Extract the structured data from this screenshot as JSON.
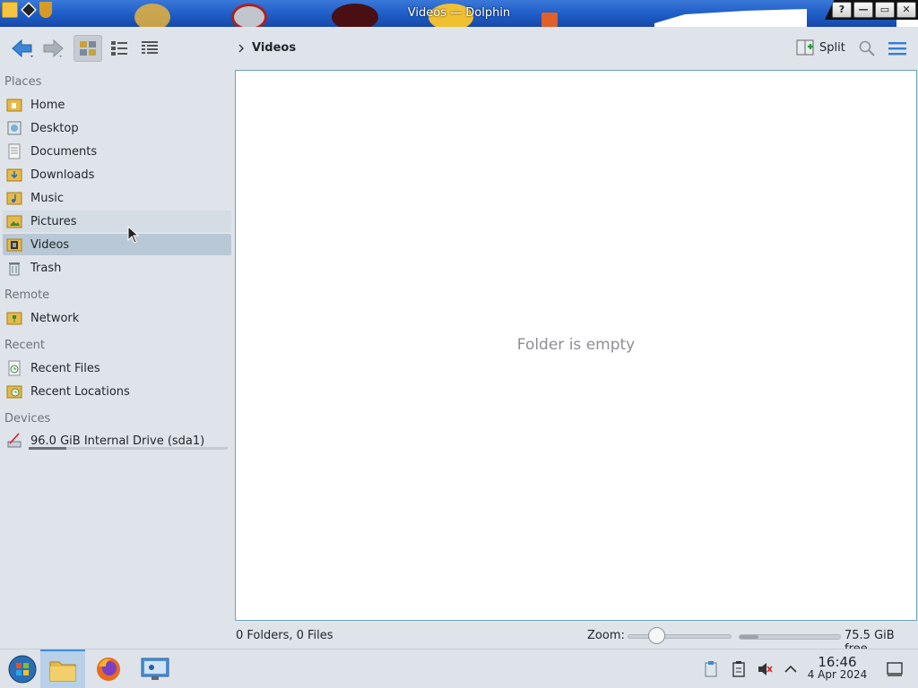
{
  "window": {
    "title": "Videos — Dolphin",
    "help_glyph": "?",
    "minimize_glyph": "—",
    "maximize_glyph": "▭",
    "close_glyph": "✕"
  },
  "toolbar": {
    "back_icon": "arrow-left-icon",
    "forward_icon": "arrow-right-icon",
    "view_modes": [
      "icons-view",
      "compact-view",
      "details-view"
    ],
    "breadcrumb": "Videos",
    "split_label": "Split",
    "search_icon": "search-icon",
    "menu_icon": "hamburger-menu-icon"
  },
  "sidebar": {
    "sections": [
      {
        "title": "Places",
        "items": [
          {
            "label": "Home",
            "icon": "home-folder-icon"
          },
          {
            "label": "Desktop",
            "icon": "desktop-folder-icon"
          },
          {
            "label": "Documents",
            "icon": "documents-folder-icon"
          },
          {
            "label": "Downloads",
            "icon": "downloads-folder-icon"
          },
          {
            "label": "Music",
            "icon": "music-folder-icon"
          },
          {
            "label": "Pictures",
            "icon": "pictures-folder-icon"
          },
          {
            "label": "Videos",
            "icon": "videos-folder-icon"
          },
          {
            "label": "Trash",
            "icon": "trash-icon"
          }
        ]
      },
      {
        "title": "Remote",
        "items": [
          {
            "label": "Network",
            "icon": "network-folder-icon"
          }
        ]
      },
      {
        "title": "Recent",
        "items": [
          {
            "label": "Recent Files",
            "icon": "recent-files-icon"
          },
          {
            "label": "Recent Locations",
            "icon": "recent-locations-icon"
          }
        ]
      },
      {
        "title": "Devices",
        "items": [
          {
            "label": "96.0 GiB Internal Drive (sda1)",
            "icon": "drive-icon",
            "usage_fraction": 0.19
          }
        ]
      }
    ],
    "selected": "Videos"
  },
  "content": {
    "empty_message": "Folder is empty"
  },
  "statusbar": {
    "summary": "0 Folders, 0 Files",
    "zoom_label": "Zoom:",
    "zoom_fraction": 0.28,
    "free_fraction": 0.19,
    "free_label": "75.5 GiB free"
  },
  "taskbar": {
    "apps": [
      "start-menu-icon",
      "dolphin-icon",
      "firefox-icon",
      "system-settings-icon"
    ],
    "tray": [
      "clipboard-icon",
      "notes-icon",
      "volume-muted-icon",
      "chevron-up-icon",
      "show-desktop-icon"
    ],
    "time": "16:46",
    "date": "4 Apr 2024"
  },
  "colors": {
    "selection": "#b8c8d6",
    "accent": "#3d8ee8",
    "content_border": "#6aa5b8"
  }
}
